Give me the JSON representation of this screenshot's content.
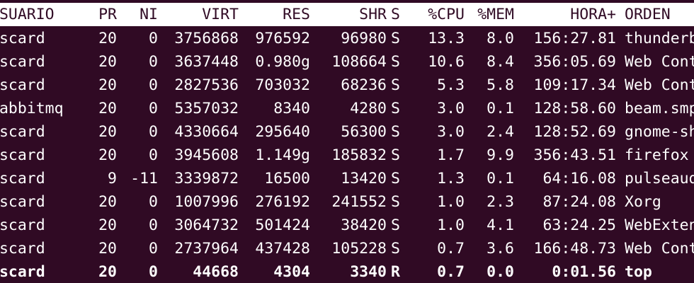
{
  "top": {
    "headers": {
      "user": "USUARIO",
      "pr": "PR",
      "ni": "NI",
      "virt": "VIRT",
      "res": "RES",
      "shr": "SHR",
      "s": "S",
      "cpu": "%CPU",
      "mem": "%MEM",
      "time": "HORA+",
      "cmd": "ORDEN"
    },
    "rows": [
      {
        "user": "oscard",
        "pr": "20",
        "ni": "0",
        "virt": "3756868",
        "res": "976592",
        "shr": "96980",
        "s": "S",
        "cpu": "13.3",
        "mem": "8.0",
        "time": "156:27.81",
        "cmd": "thunderbird",
        "bold": false
      },
      {
        "user": "oscard",
        "pr": "20",
        "ni": "0",
        "virt": "3637448",
        "res": "0.980g",
        "shr": "108664",
        "s": "S",
        "cpu": "10.6",
        "mem": "8.4",
        "time": "356:05.69",
        "cmd": "Web Content",
        "bold": false
      },
      {
        "user": "oscard",
        "pr": "20",
        "ni": "0",
        "virt": "2827536",
        "res": "703032",
        "shr": "68236",
        "s": "S",
        "cpu": "5.3",
        "mem": "5.8",
        "time": "109:17.34",
        "cmd": "Web Content",
        "bold": false
      },
      {
        "user": "rabbitmq",
        "pr": "20",
        "ni": "0",
        "virt": "5357032",
        "res": "8340",
        "shr": "4280",
        "s": "S",
        "cpu": "3.0",
        "mem": "0.1",
        "time": "128:58.60",
        "cmd": "beam.smp",
        "bold": false
      },
      {
        "user": "oscard",
        "pr": "20",
        "ni": "0",
        "virt": "4330664",
        "res": "295640",
        "shr": "56300",
        "s": "S",
        "cpu": "3.0",
        "mem": "2.4",
        "time": "128:52.69",
        "cmd": "gnome-shell",
        "bold": false
      },
      {
        "user": "oscard",
        "pr": "20",
        "ni": "0",
        "virt": "3945608",
        "res": "1.149g",
        "shr": "185832",
        "s": "S",
        "cpu": "1.7",
        "mem": "9.9",
        "time": "356:43.51",
        "cmd": "firefox",
        "bold": false
      },
      {
        "user": "oscard",
        "pr": "9",
        "ni": "-11",
        "virt": "3339872",
        "res": "16500",
        "shr": "13420",
        "s": "S",
        "cpu": "1.3",
        "mem": "0.1",
        "time": "64:16.08",
        "cmd": "pulseaudio",
        "bold": false
      },
      {
        "user": "oscard",
        "pr": "20",
        "ni": "0",
        "virt": "1007996",
        "res": "276192",
        "shr": "241552",
        "s": "S",
        "cpu": "1.0",
        "mem": "2.3",
        "time": "87:24.08",
        "cmd": "Xorg",
        "bold": false
      },
      {
        "user": "oscard",
        "pr": "20",
        "ni": "0",
        "virt": "3064732",
        "res": "501424",
        "shr": "38420",
        "s": "S",
        "cpu": "1.0",
        "mem": "4.1",
        "time": "63:24.25",
        "cmd": "WebExtensions",
        "bold": false
      },
      {
        "user": "oscard",
        "pr": "20",
        "ni": "0",
        "virt": "2737964",
        "res": "437428",
        "shr": "105228",
        "s": "S",
        "cpu": "0.7",
        "mem": "3.6",
        "time": "166:48.73",
        "cmd": "Web Content",
        "bold": false
      },
      {
        "user": "oscard",
        "pr": "20",
        "ni": "0",
        "virt": "44668",
        "res": "4304",
        "shr": "3340",
        "s": "R",
        "cpu": "0.7",
        "mem": "0.0",
        "time": "0:01.56",
        "cmd": "top",
        "bold": true
      }
    ]
  },
  "colors": {
    "background": "#300a24",
    "foreground": "#ffffff",
    "header_background": "#ffffff",
    "header_foreground": "#300a24"
  }
}
